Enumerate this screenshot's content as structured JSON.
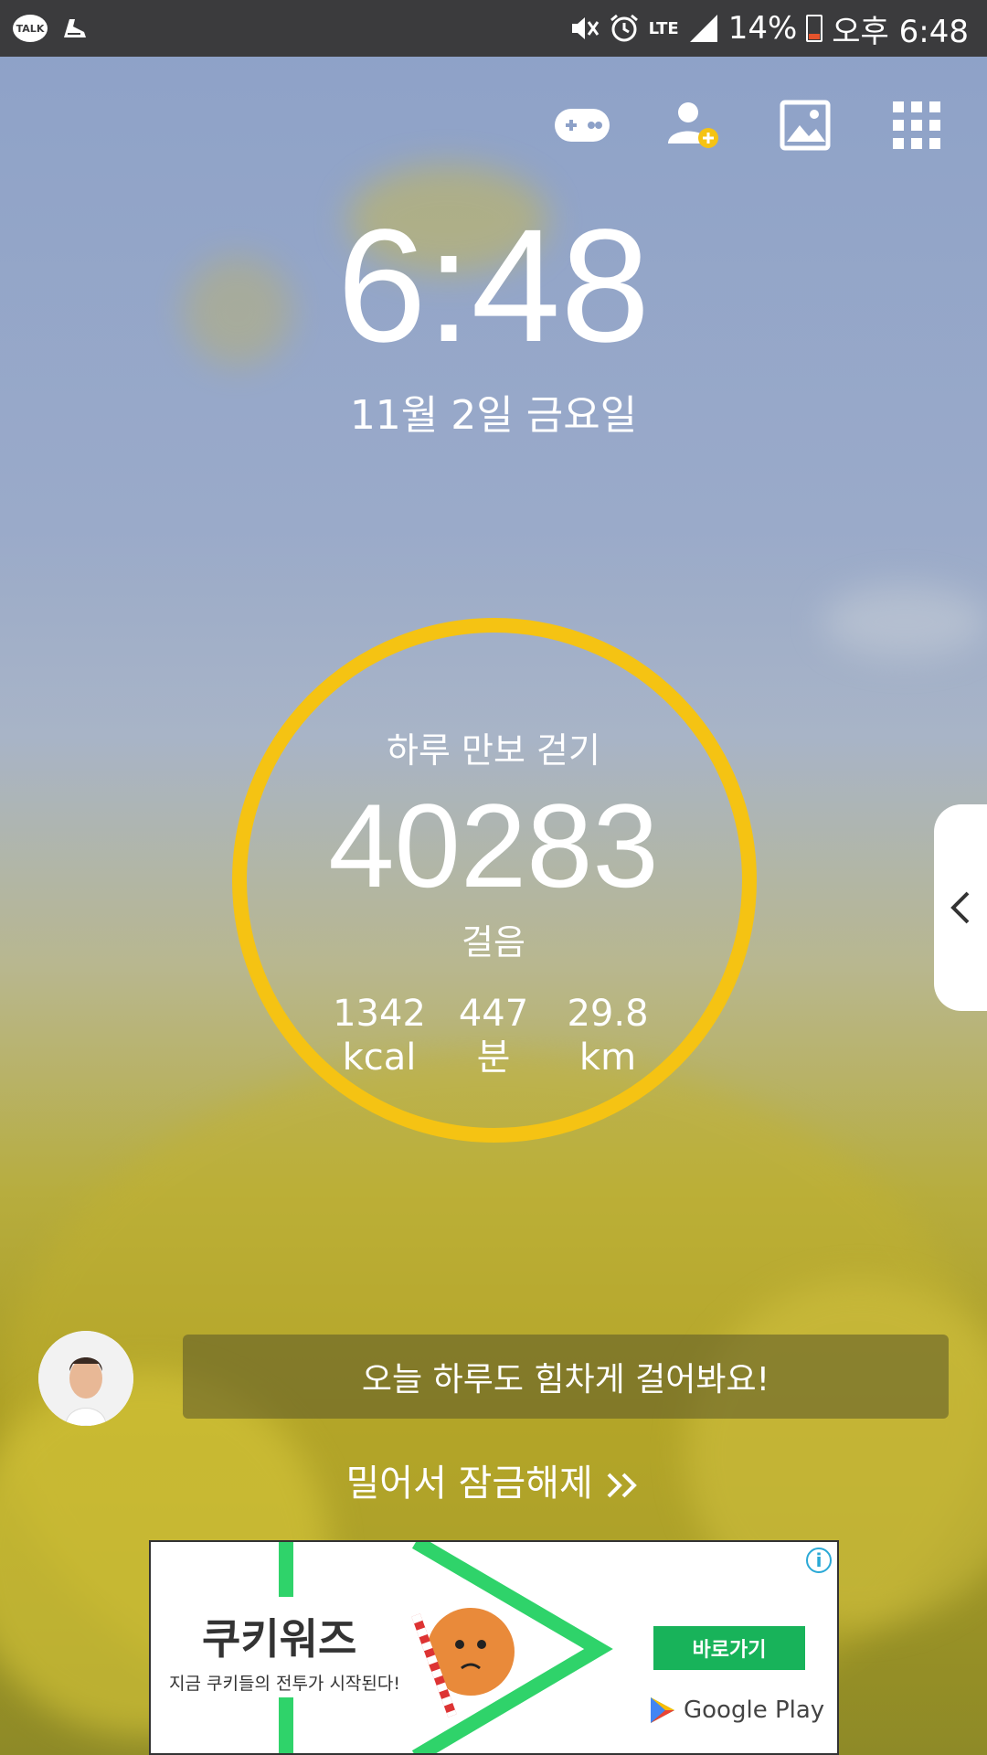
{
  "status_bar": {
    "talk_label": "TALK",
    "battery": "14%",
    "time": "오후 6:48",
    "network": "LTE"
  },
  "top_icons": [
    "game-controller-icon",
    "add-person-icon",
    "gallery-icon",
    "apps-grid-icon"
  ],
  "clock": {
    "time": "6:48",
    "date": "11월 2일 금요일"
  },
  "pedometer": {
    "title": "하루 만보 걷기",
    "steps": "40283",
    "steps_unit": "걸음",
    "stats": [
      {
        "value": "1342",
        "unit": "kcal"
      },
      {
        "value": "447",
        "unit": "분"
      },
      {
        "value": "29.8",
        "unit": "km"
      }
    ],
    "ring_color": "#f5c313"
  },
  "message": "오늘 하루도 힘차게 걸어봐요!",
  "unlock_text": "밀어서 잠금해제",
  "ad": {
    "title": "쿠키워즈",
    "subtitle": "지금 쿠키들의 전투가 시작된다!",
    "button": "바로가기",
    "store": "Google Play",
    "accent": "#18b35a"
  }
}
